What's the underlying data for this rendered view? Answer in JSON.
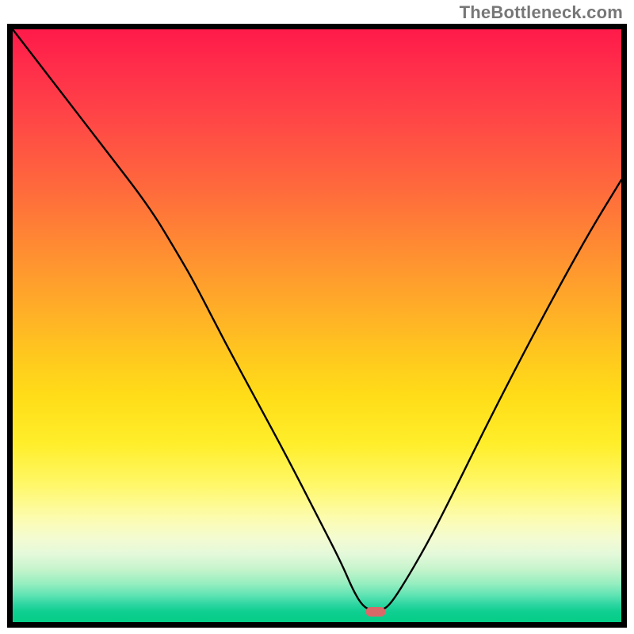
{
  "watermark": "TheBottleneck.com",
  "colors": {
    "frame": "#000000",
    "marker": "#d96868",
    "curve": "#000000"
  },
  "chart_data": {
    "type": "line",
    "title": "",
    "xlabel": "",
    "ylabel": "",
    "xlim": [
      0,
      1
    ],
    "ylim": [
      0,
      1
    ],
    "marker": {
      "x": 0.596,
      "y": 0.982
    },
    "curve": [
      {
        "x": 0.0,
        "y": 0.0
      },
      {
        "x": 0.075,
        "y": 0.1
      },
      {
        "x": 0.15,
        "y": 0.2
      },
      {
        "x": 0.225,
        "y": 0.3
      },
      {
        "x": 0.272,
        "y": 0.38
      },
      {
        "x": 0.3,
        "y": 0.43
      },
      {
        "x": 0.35,
        "y": 0.53
      },
      {
        "x": 0.4,
        "y": 0.625
      },
      {
        "x": 0.45,
        "y": 0.72
      },
      {
        "x": 0.5,
        "y": 0.82
      },
      {
        "x": 0.54,
        "y": 0.9
      },
      {
        "x": 0.56,
        "y": 0.948
      },
      {
        "x": 0.576,
        "y": 0.974
      },
      {
        "x": 0.59,
        "y": 0.98
      },
      {
        "x": 0.605,
        "y": 0.98
      },
      {
        "x": 0.618,
        "y": 0.973
      },
      {
        "x": 0.64,
        "y": 0.94
      },
      {
        "x": 0.68,
        "y": 0.87
      },
      {
        "x": 0.72,
        "y": 0.79
      },
      {
        "x": 0.78,
        "y": 0.665
      },
      {
        "x": 0.84,
        "y": 0.545
      },
      {
        "x": 0.9,
        "y": 0.43
      },
      {
        "x": 0.95,
        "y": 0.338
      },
      {
        "x": 1.0,
        "y": 0.254
      }
    ],
    "gradient_stops": [
      {
        "offset": 0.0,
        "color": "#ff1a4a"
      },
      {
        "offset": 0.5,
        "color": "#ffcc20"
      },
      {
        "offset": 0.8,
        "color": "#fcfcb0"
      },
      {
        "offset": 1.0,
        "color": "#04cd86"
      }
    ]
  }
}
